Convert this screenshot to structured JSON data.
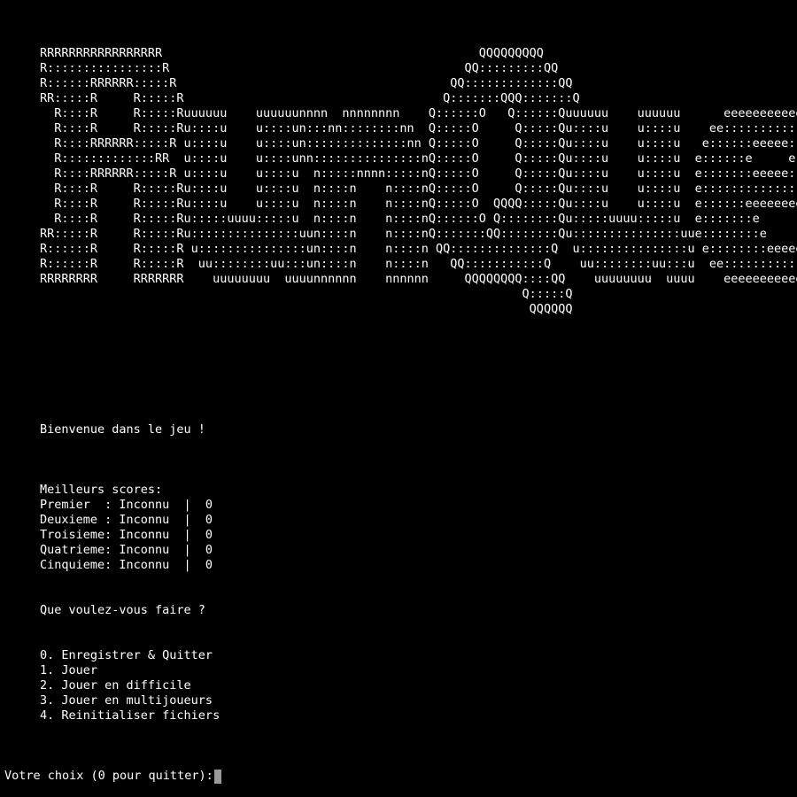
{
  "banner": {
    "lines": [
      "RRRRRRRRRRRRRRRRR                                            QQQQQQQQQ",
      "R::::::::::::::::R                                         QQ:::::::::QQ",
      "R::::::RRRRRR:::::R                                      QQ:::::::::::::QQ",
      "RR:::::R     R:::::R                                    Q:::::::QQQ:::::::Q",
      "  R::::R     R:::::Ruuuuuu    uuuuuunnnn  nnnnnnnn    Q::::::O   Q::::::Quuuuuu    uuuuuu      eeeeeeeeeeee",
      "  R::::R     R:::::Ru::::u    u::::un:::nn::::::::nn  Q:::::O     Q:::::Qu::::u    u::::u    ee::::::::::::ee",
      "  R::::RRRRRR:::::R u::::u    u::::un::::::::::::::nn Q:::::O     Q:::::Qu::::u    u::::u   e::::::eeeee:::::ee",
      "  R:::::::::::::RR  u::::u    u::::unn:::::::::::::::nQ:::::O     Q:::::Qu::::u    u::::u  e::::::e     e:::::e",
      "  R::::RRRRRR:::::R u::::u    u::::u  n:::::nnnn:::::nQ:::::O     Q:::::Qu::::u    u::::u  e:::::::eeeee::::::e",
      "  R::::R     R:::::Ru::::u    u::::u  n::::n    n::::nQ:::::O     Q:::::Qu::::u    u::::u  e:::::::::::::::::e",
      "  R::::R     R:::::Ru::::u    u::::u  n::::n    n::::nQ:::::O  QQQQ:::::Qu::::u    u::::u  e::::::eeeeeeeeeee",
      "  R::::R     R:::::Ru:::::uuuu:::::u  n::::n    n::::nQ::::::O Q::::::::Qu:::::uuuu:::::u  e:::::::e",
      "RR:::::R     R:::::Ru:::::::::::::::uun::::n    n::::nQ:::::::QQ::::::::Qu:::::::::::::::uue::::::::e",
      "R::::::R     R:::::R u:::::::::::::::un::::n    n::::n QQ::::::::::::::Q  u:::::::::::::::u e::::::::eeeeeeee",
      "R::::::R     R:::::R  uu::::::::uu:::un::::n    n::::n   QQ:::::::::::Q    uu::::::::uu:::u  ee:::::::::::::e",
      "RRRRRRRR     RRRRRRR    uuuuuuuu  uuuunnnnnn    nnnnnn     QQQQQQQQ::::QQ    uuuuuuuu  uuuu    eeeeeeeeeeeeee",
      "                                                                   Q:::::Q",
      "                                                                    QQQQQQ"
    ]
  },
  "welcome": "Bienvenue dans le jeu !",
  "scores": {
    "header": "Meilleurs scores:",
    "rows": [
      "Premier  : Inconnu  |  0",
      "Deuxieme : Inconnu  |  0",
      "Troisieme: Inconnu  |  0",
      "Quatrieme: Inconnu  |  0",
      "Cinquieme: Inconnu  |  0"
    ]
  },
  "question": "Que voulez-vous faire ?",
  "menu": [
    "0. Enregistrer & Quitter",
    "1. Jouer",
    "2. Jouer en difficile",
    "3. Jouer en multijoueurs",
    "4. Reinitialiser fichiers"
  ],
  "prompt": "Votre choix (0 pour quitter):"
}
